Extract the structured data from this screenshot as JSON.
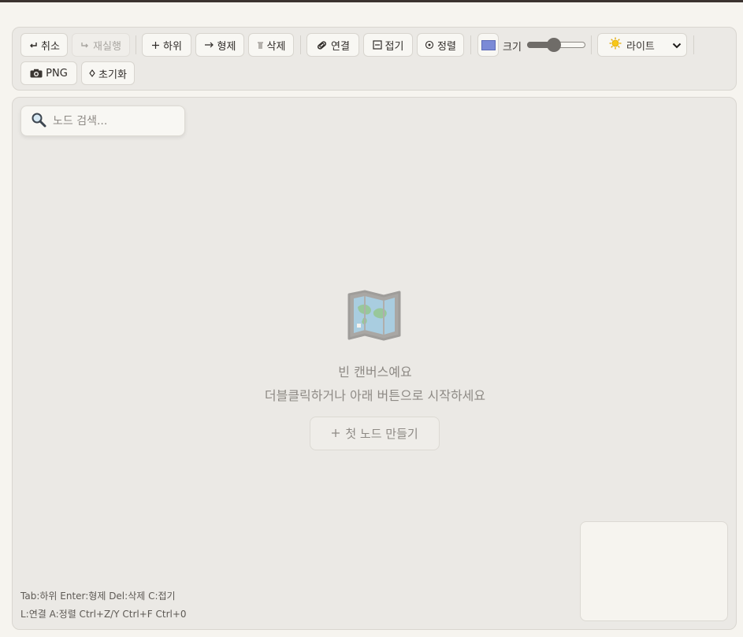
{
  "toolbar": {
    "undo": {
      "icon": "undo-arrow-icon",
      "label": "취소"
    },
    "redo": {
      "icon": "redo-arrow-icon",
      "label": "재실행"
    },
    "add_child": {
      "icon": "plus-icon",
      "label": "하위"
    },
    "add_sibling": {
      "icon": "arrow-right-icon",
      "label": "형제"
    },
    "delete": {
      "icon": "trash-icon",
      "label": "삭제"
    },
    "link": {
      "icon": "paperclip-icon",
      "label": "연결"
    },
    "collapse": {
      "icon": "collapse-box-icon",
      "label": "접기"
    },
    "align": {
      "icon": "target-icon",
      "label": "정렬"
    },
    "color_swatch": "#7b8ad6",
    "size_label": "크기",
    "size_slider_value": 0.45,
    "theme": {
      "icon": "sun-icon",
      "selected": "라이트"
    },
    "export_png": {
      "icon": "camera-icon",
      "label": "PNG"
    },
    "reset": {
      "icon": "diamond-icon",
      "label": "초기화"
    }
  },
  "search": {
    "placeholder": "노드 검색..."
  },
  "empty_state": {
    "icon": "map-icon",
    "title": "빈 캔버스예요",
    "subtitle": "더블클릭하거나 아래 버튼으로 시작하세요",
    "button_label": "첫 노드 만들기"
  },
  "shortcuts": {
    "line1": "Tab:하위 Enter:형제 Del:삭제 C:접기",
    "line2": "L:연결 A:정렬 Ctrl+Z/Y Ctrl+F Ctrl+0"
  },
  "colors": {
    "background": "#f6f4ef",
    "panel": "#ebe9e5",
    "accent_swatch": "#7b8ad6"
  }
}
